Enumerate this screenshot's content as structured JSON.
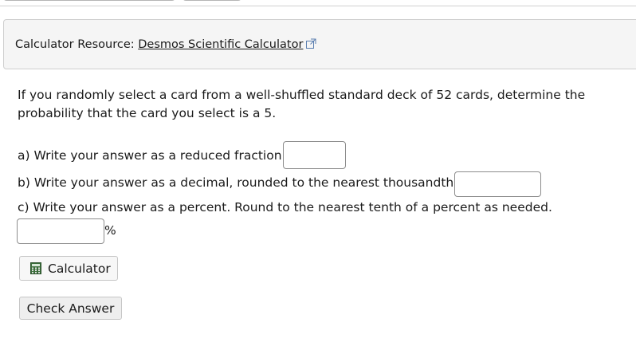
{
  "resource": {
    "prefix": "Calculator Resource: ",
    "link_text": "Desmos Scientific Calculator",
    "external_icon": "external-link-icon"
  },
  "question": {
    "text": "If you randomly select a card from a well-shuffled standard deck of 52 cards, determine the probability that the card you select is a 5."
  },
  "parts": {
    "a": {
      "text": "a) Write your answer as a reduced fraction.",
      "value": ""
    },
    "b": {
      "text": "b) Write your answer as a decimal, rounded to the nearest thousandth.",
      "value": ""
    },
    "c": {
      "text": "c) Write your answer as a percent. Round to the nearest tenth of a percent as needed.",
      "value": "",
      "suffix": "%"
    }
  },
  "buttons": {
    "calculator_label": "Calculator",
    "calculator_icon": "calculator-icon",
    "check_label": "Check Answer"
  },
  "colors": {
    "resource_bg": "#f5f5f5",
    "border": "#8c8c8c",
    "calc_icon": "#2e7d32"
  }
}
